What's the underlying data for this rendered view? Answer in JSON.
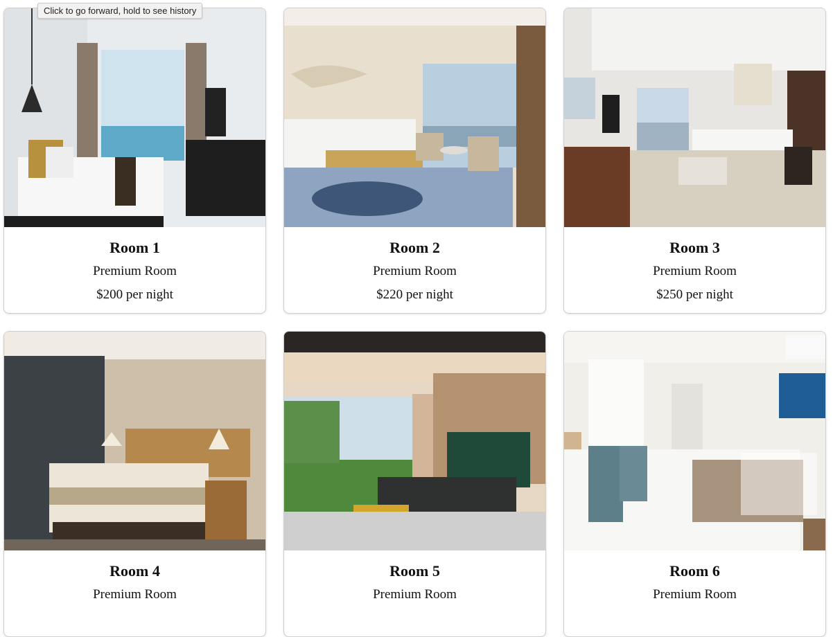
{
  "tooltip": "Click to go forward, hold to see history",
  "rooms": [
    {
      "name": "Room 1",
      "type": "Premium Room",
      "price": "$200 per night",
      "photo_icon": "bedroom-photo-ocean-view"
    },
    {
      "name": "Room 2",
      "type": "Premium Room",
      "price": "$220 per night",
      "photo_icon": "bedroom-photo-harbor-view"
    },
    {
      "name": "Room 3",
      "type": "Premium Room",
      "price": "$250 per night",
      "photo_icon": "bedroom-photo-city-view"
    },
    {
      "name": "Room 4",
      "type": "Premium Room",
      "price": "",
      "photo_icon": "bedroom-photo-classic"
    },
    {
      "name": "Room 5",
      "type": "Premium Room",
      "price": "",
      "photo_icon": "bedroom-photo-garden-view"
    },
    {
      "name": "Room 6",
      "type": "Premium Room",
      "price": "",
      "photo_icon": "bedroom-photo-compact"
    }
  ],
  "colors": {
    "card_border": "#cfcfcf",
    "text": "#111111",
    "tooltip_bg": "#f2f2f2"
  }
}
